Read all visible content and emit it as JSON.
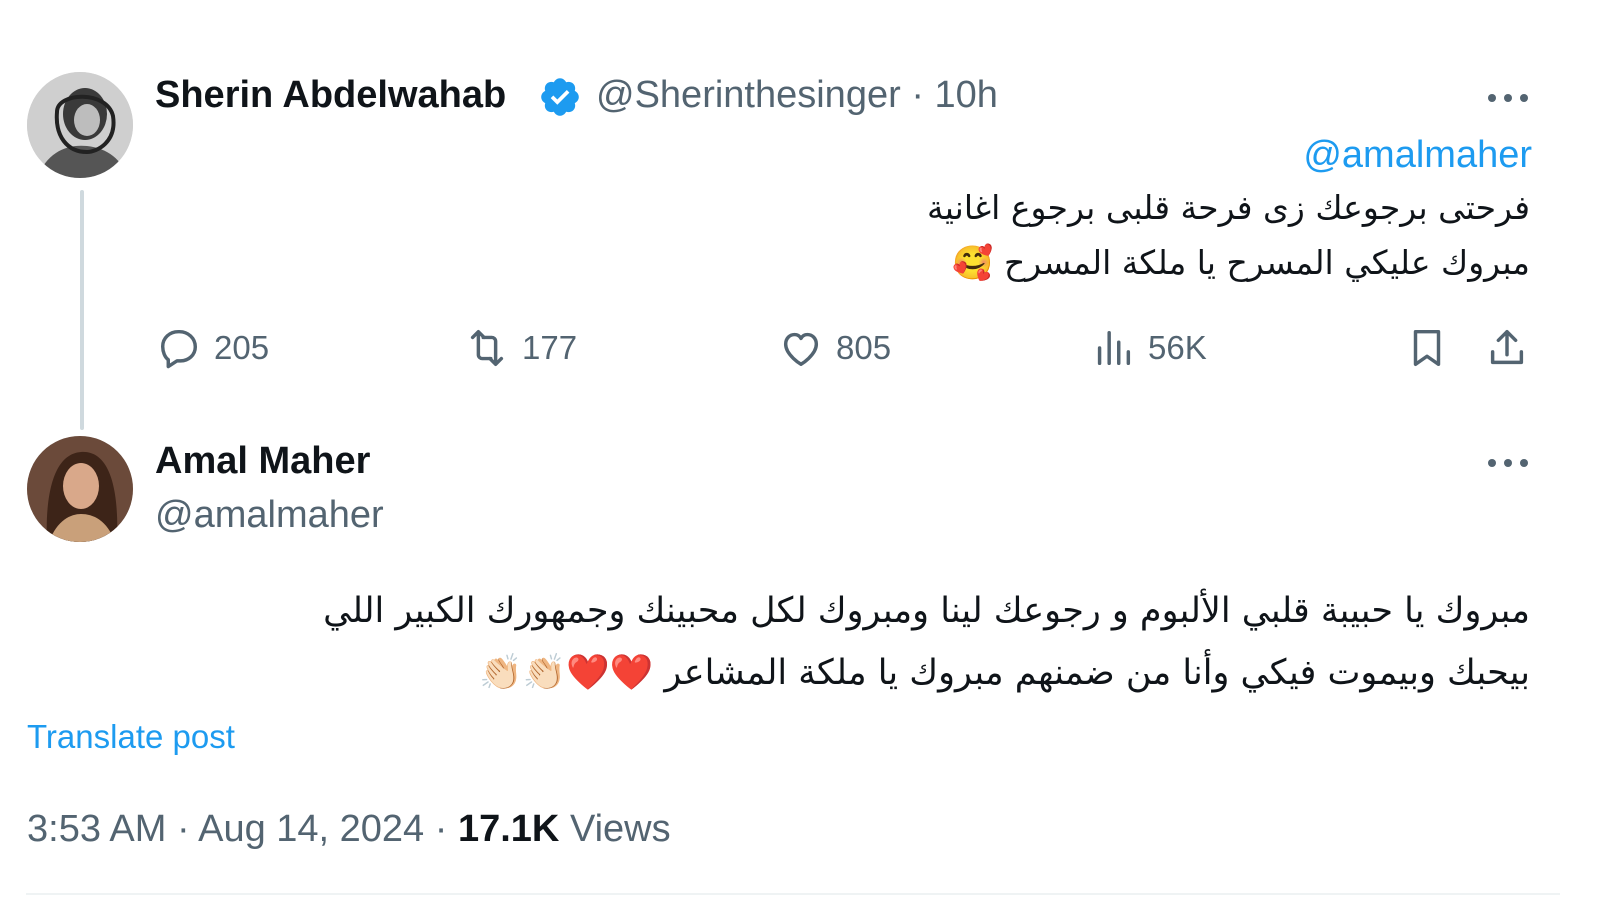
{
  "original_post": {
    "author_name": "Sherin Abdelwahab",
    "handle": "@Sherinthesinger",
    "separator": "·",
    "time": "10h",
    "mention": "@amalmaher",
    "text_line1": "فرحتى برجوعك زى فرحة قلبى برجوع اغانية",
    "text_line2": "مبروك عليكي المسرح يا ملكة المسرح 🥰",
    "replies": "205",
    "reposts": "177",
    "likes": "805",
    "views": "56K"
  },
  "reply_post": {
    "author_name": "Amal Maher",
    "handle": "@amalmaher",
    "text_line1": "مبروك يا حبيبة قلبي الألبوم و رجوعك لينا ومبروك لكل محبينك وجمهورك الكبير اللي",
    "text_line2": "بيحبك وبيموت فيكي وأنا من ضمنهم مبروك يا ملكة المشاعر ❤️❤️👏🏻👏🏻",
    "translate_label": "Translate post",
    "timestamp": "3:53 AM · Aug 14, 2024 ·",
    "view_count": "17.1K",
    "views_label": "Views"
  },
  "colors": {
    "accent": "#1d9bf0",
    "secondary_text": "#536471",
    "primary_text": "#0f1419"
  },
  "icons": [
    "verified-badge-icon",
    "more-icon",
    "reply-icon",
    "repost-icon",
    "like-icon",
    "views-icon",
    "bookmark-icon",
    "share-icon"
  ]
}
